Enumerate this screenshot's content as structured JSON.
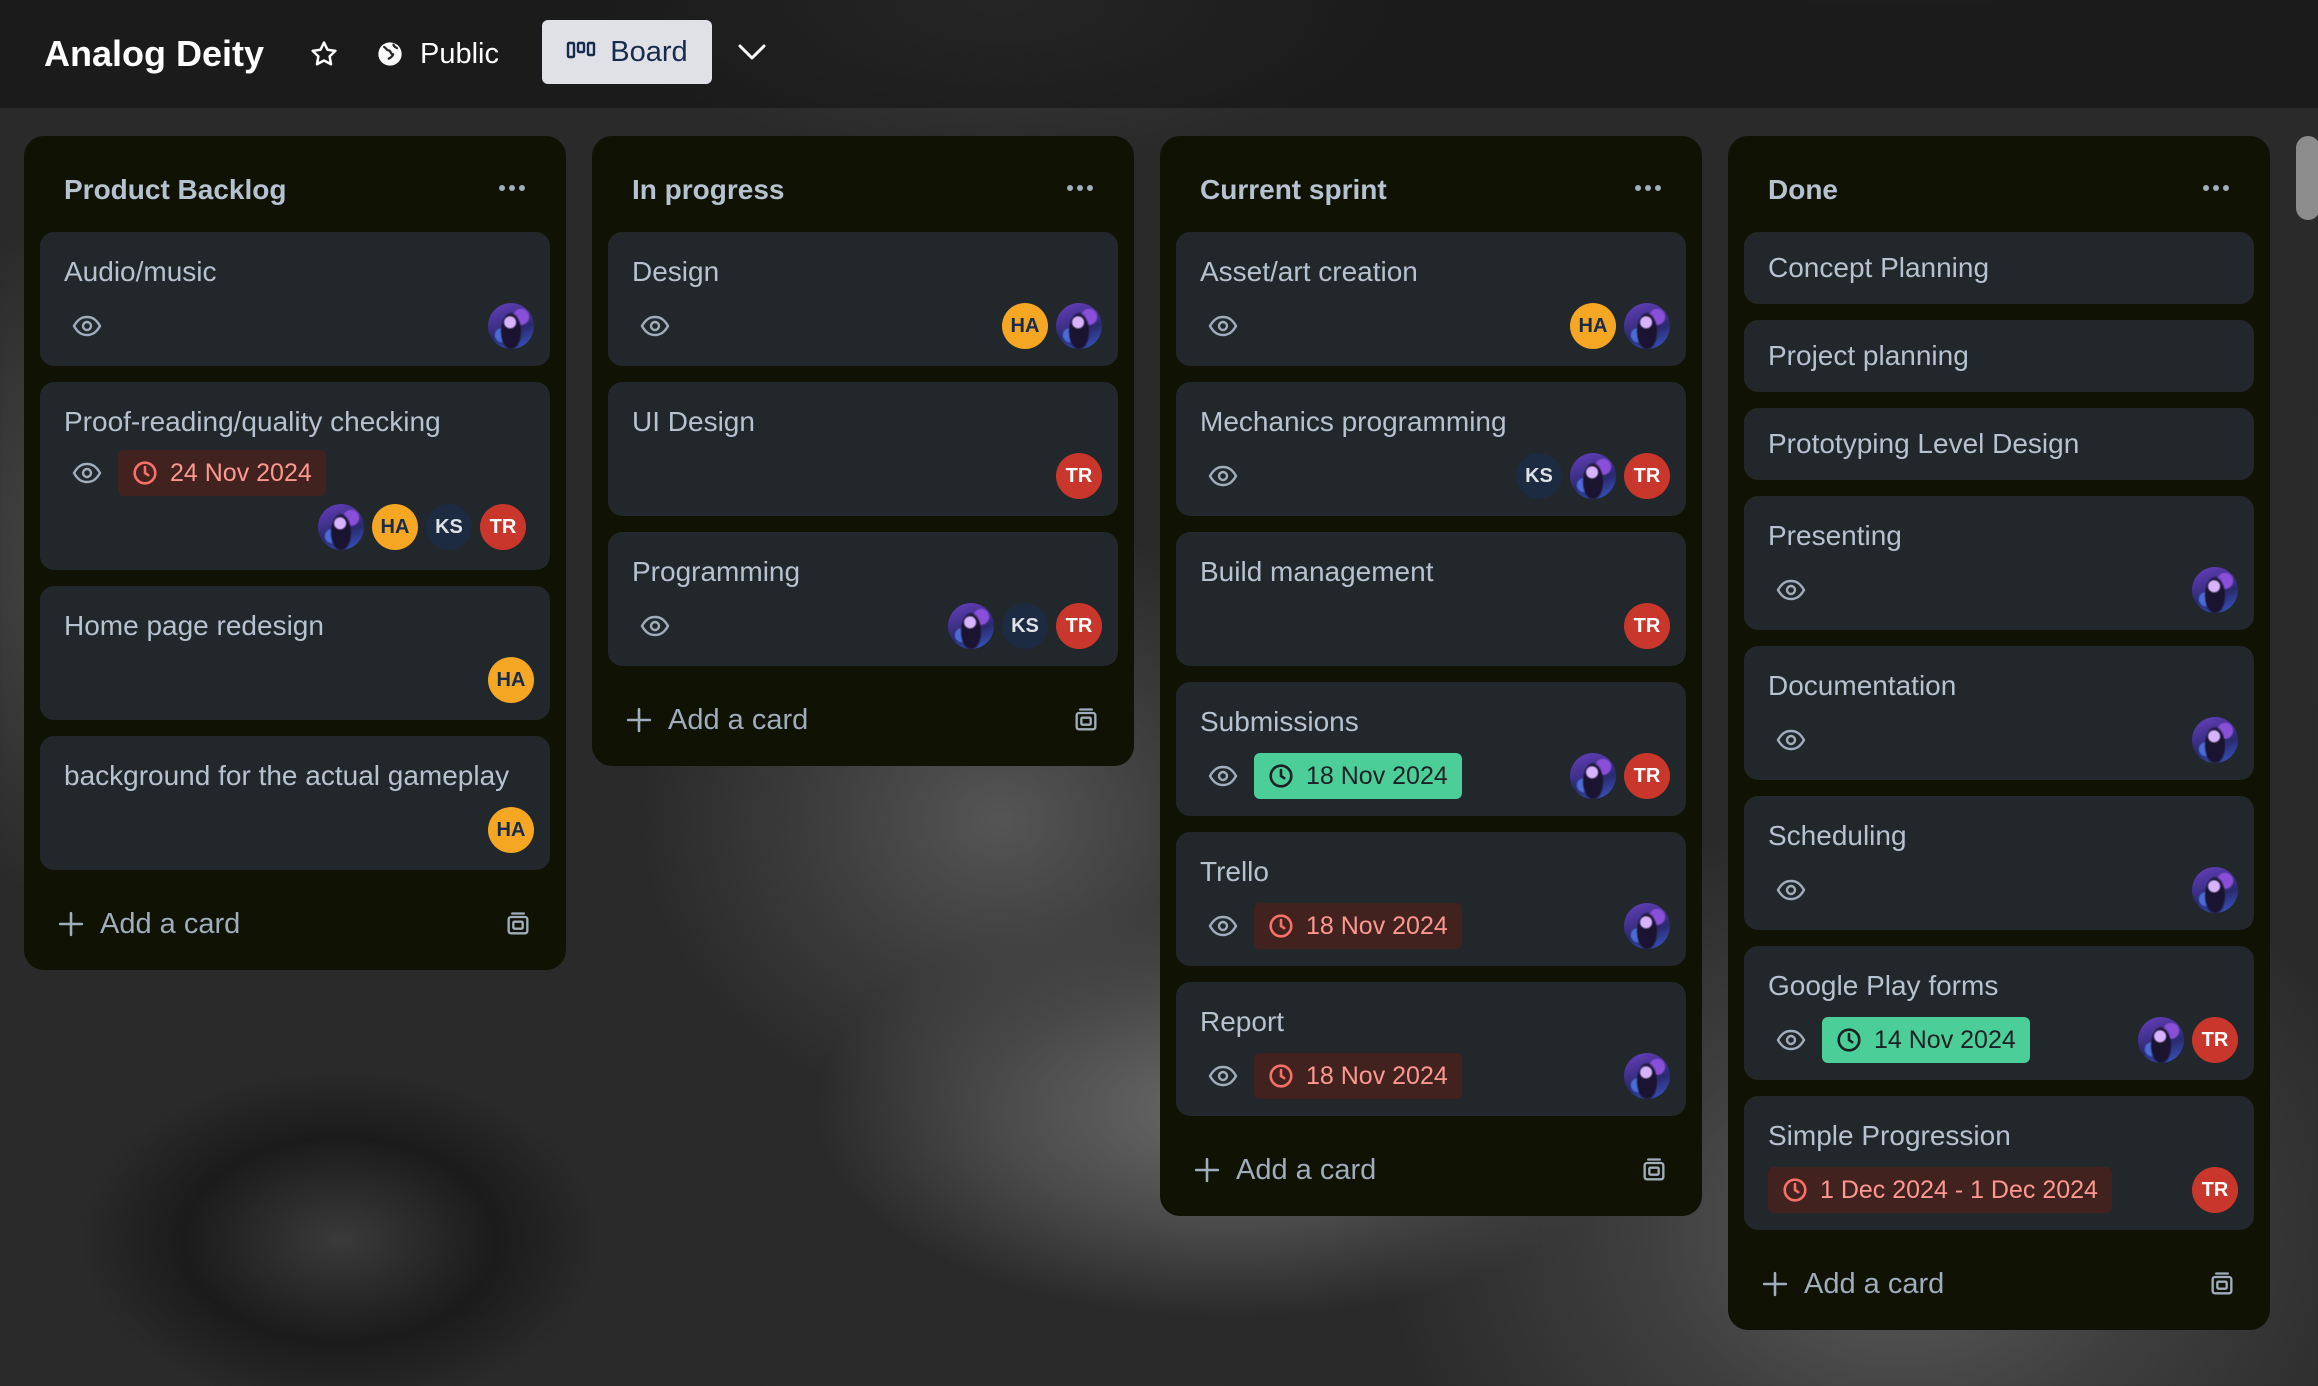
{
  "header": {
    "board_title": "Analog Deity",
    "visibility_label": "Public",
    "view_label": "Board"
  },
  "colors": {
    "list_bg": "#101204",
    "card_bg": "#22272b",
    "text": "#b6c2cf",
    "overdue_bg": "#42221f",
    "overdue_text": "#fd9891",
    "complete_bg": "#4bce97",
    "avatar_ha": "#f5a623",
    "avatar_ks": "#1c2b41",
    "avatar_tr": "#c9372c"
  },
  "lists": [
    {
      "title": "Product Backlog",
      "add_label": "Add a card",
      "cards": [
        {
          "title": "Audio/music",
          "watch": true,
          "members": [
            "photo"
          ]
        },
        {
          "title": "Proof-reading/quality checking",
          "watch": true,
          "due": {
            "label": "24 Nov 2024",
            "state": "overdue"
          },
          "members": [
            "photo",
            "HA",
            "KS",
            "TR"
          ]
        },
        {
          "title": "Home page redesign",
          "members": [
            "HA"
          ]
        },
        {
          "title": "background for the actual gameplay",
          "members": [
            "HA"
          ]
        }
      ]
    },
    {
      "title": "In progress",
      "add_label": "Add a card",
      "cards": [
        {
          "title": "Design",
          "watch": true,
          "members": [
            "HA",
            "photo"
          ]
        },
        {
          "title": "UI Design",
          "members": [
            "TR"
          ]
        },
        {
          "title": "Programming",
          "watch": true,
          "members": [
            "photo",
            "KS",
            "TR"
          ]
        }
      ]
    },
    {
      "title": "Current sprint",
      "add_label": "Add a card",
      "cards": [
        {
          "title": "Asset/art creation",
          "watch": true,
          "members": [
            "HA",
            "photo"
          ]
        },
        {
          "title": "Mechanics programming",
          "watch": true,
          "members": [
            "KS",
            "photo",
            "TR"
          ]
        },
        {
          "title": "Build management",
          "members": [
            "TR"
          ]
        },
        {
          "title": "Submissions",
          "watch": true,
          "due": {
            "label": "18 Nov 2024",
            "state": "done"
          },
          "members": [
            "photo",
            "TR"
          ]
        },
        {
          "title": "Trello",
          "watch": true,
          "due": {
            "label": "18 Nov 2024",
            "state": "overdue"
          },
          "members": [
            "photo"
          ]
        },
        {
          "title": "Report",
          "watch": true,
          "due": {
            "label": "18 Nov 2024",
            "state": "overdue"
          },
          "members": [
            "photo"
          ]
        }
      ]
    },
    {
      "title": "Done",
      "add_label": "Add a card",
      "cards": [
        {
          "title": "Concept Planning"
        },
        {
          "title": "Project planning"
        },
        {
          "title": "Prototyping Level Design"
        },
        {
          "title": "Presenting",
          "watch": true,
          "members": [
            "photo"
          ]
        },
        {
          "title": "Documentation",
          "watch": true,
          "members": [
            "photo"
          ]
        },
        {
          "title": "Scheduling",
          "watch": true,
          "members": [
            "photo"
          ]
        },
        {
          "title": "Google Play forms",
          "watch": true,
          "due": {
            "label": "14 Nov 2024",
            "state": "done"
          },
          "members": [
            "photo",
            "TR"
          ]
        },
        {
          "title": "Simple Progression",
          "due": {
            "label": "1 Dec 2024 - 1 Dec 2024",
            "state": "overdue"
          },
          "members": [
            "TR"
          ]
        }
      ]
    }
  ]
}
